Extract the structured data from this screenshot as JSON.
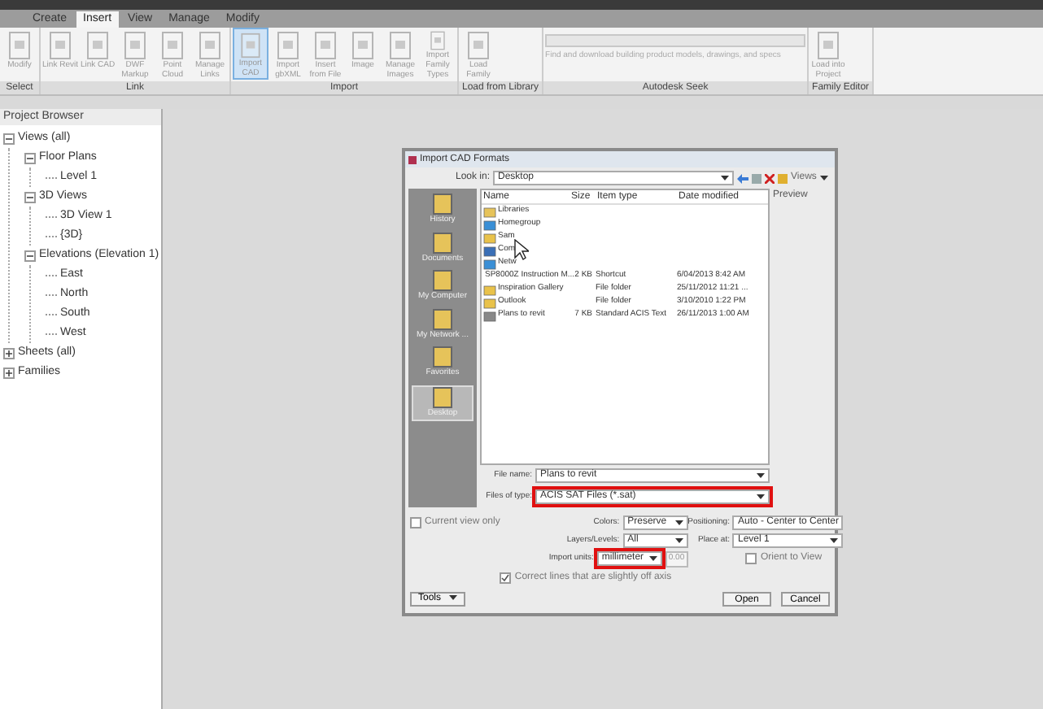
{
  "ribbon": {
    "tabs": [
      {
        "label": "Create",
        "selected": false
      },
      {
        "label": "Insert",
        "selected": true
      },
      {
        "label": "View",
        "selected": false
      },
      {
        "label": "Manage",
        "selected": false
      },
      {
        "label": "Modify",
        "selected": false
      }
    ],
    "groups": [
      {
        "label": "Select",
        "buttons": [
          {
            "label": "Modify",
            "selected": false
          }
        ]
      },
      {
        "label": "Link",
        "buttons": [
          {
            "label": "Link Revit",
            "selected": false
          },
          {
            "label": "Link CAD",
            "selected": false
          },
          {
            "label": "DWF Markup",
            "selected": false
          },
          {
            "label": "Point Cloud",
            "selected": false
          },
          {
            "label": "Manage Links",
            "selected": false
          }
        ]
      },
      {
        "label": "Import",
        "buttons": [
          {
            "label": "Import CAD",
            "selected": true
          },
          {
            "label": "Import gbXML",
            "selected": false
          },
          {
            "label": "Insert from File",
            "selected": false
          },
          {
            "label": "Image",
            "selected": false
          },
          {
            "label": "Manage Images",
            "selected": false
          },
          {
            "label": "Import Family Types",
            "selected": false
          }
        ]
      },
      {
        "label": "Load from Library",
        "buttons": [
          {
            "label": "Load Family",
            "selected": false
          }
        ]
      },
      {
        "label": "Autodesk Seek",
        "search_placeholder": "Find and download building product models, drawings, and specs"
      },
      {
        "label": "Family Editor",
        "buttons": [
          {
            "label": "Load into Project",
            "selected": false
          }
        ]
      }
    ]
  },
  "project_browser": {
    "title": "Project Browser",
    "tree": [
      {
        "label": "Views (all)",
        "expanded": true,
        "children": [
          {
            "label": "Floor Plans",
            "expanded": true,
            "children": [
              {
                "label": "Level 1"
              }
            ]
          },
          {
            "label": "3D Views",
            "expanded": true,
            "children": [
              {
                "label": "3D View 1"
              },
              {
                "label": "{3D}"
              }
            ]
          },
          {
            "label": "Elevations (Elevation 1)",
            "expanded": true,
            "children": [
              {
                "label": "East"
              },
              {
                "label": "North"
              },
              {
                "label": "South"
              },
              {
                "label": "West"
              }
            ]
          }
        ]
      },
      {
        "label": "Sheets (all)",
        "expanded": false
      },
      {
        "label": "Families",
        "expanded": false
      }
    ]
  },
  "dialog": {
    "title": "Import CAD Formats",
    "look_in_label": "Look in:",
    "look_in": "Desktop",
    "preview_label": "Preview",
    "views_label": "Views",
    "places": [
      {
        "label": "History",
        "selected": false
      },
      {
        "label": "Documents",
        "selected": false
      },
      {
        "label": "My Computer",
        "selected": false
      },
      {
        "label": "My Network ...",
        "selected": false
      },
      {
        "label": "Favorites",
        "selected": false
      },
      {
        "label": "Desktop",
        "selected": true
      }
    ],
    "columns": [
      "Name",
      "Size",
      "Item type",
      "Date modified"
    ],
    "files": [
      {
        "kind": "library",
        "name": "Libraries"
      },
      {
        "kind": "network",
        "name": "Homegroup"
      },
      {
        "kind": "folder",
        "name": "Sam"
      },
      {
        "kind": "computer",
        "name": "Com"
      },
      {
        "kind": "network",
        "name": "Netw"
      },
      {
        "kind": "pdf",
        "name": "SP8000Z Instruction M...",
        "size": "2 KB",
        "type": "Shortcut",
        "date": "6/04/2013 8:42 AM"
      },
      {
        "kind": "folder",
        "name": "Inspiration Gallery",
        "type": "File folder",
        "date": "25/11/2012 11:21 ..."
      },
      {
        "kind": "folder",
        "name": "Outlook",
        "type": "File folder",
        "date": "3/10/2010 1:22 PM"
      },
      {
        "kind": "file",
        "name": "Plans to revit",
        "size": "7 KB",
        "type": "Standard ACIS Text",
        "date": "26/11/2013 1:00 AM"
      }
    ],
    "file_name_label": "File name:",
    "file_name": "Plans to revit",
    "file_type_label": "Files of type:",
    "file_type": "ACIS SAT Files (*.sat)",
    "current_view_only": {
      "label": "Current view only",
      "checked": false
    },
    "colors_label": "Colors:",
    "colors": "Preserve",
    "layers_label": "Layers/Levels:",
    "layers": "All",
    "units_label": "Import units:",
    "units": "millimeter",
    "scale": "0.00",
    "correct_lines": {
      "label": "Correct lines that are slightly off axis",
      "checked": true
    },
    "positioning_label": "Positioning:",
    "positioning": "Auto - Center to Center",
    "place_at_label": "Place at:",
    "place_at": "Level 1",
    "orient_to_view": {
      "label": "Orient to View",
      "checked": false
    },
    "tools_button": "Tools",
    "open_button": "Open",
    "cancel_button": "Cancel"
  }
}
